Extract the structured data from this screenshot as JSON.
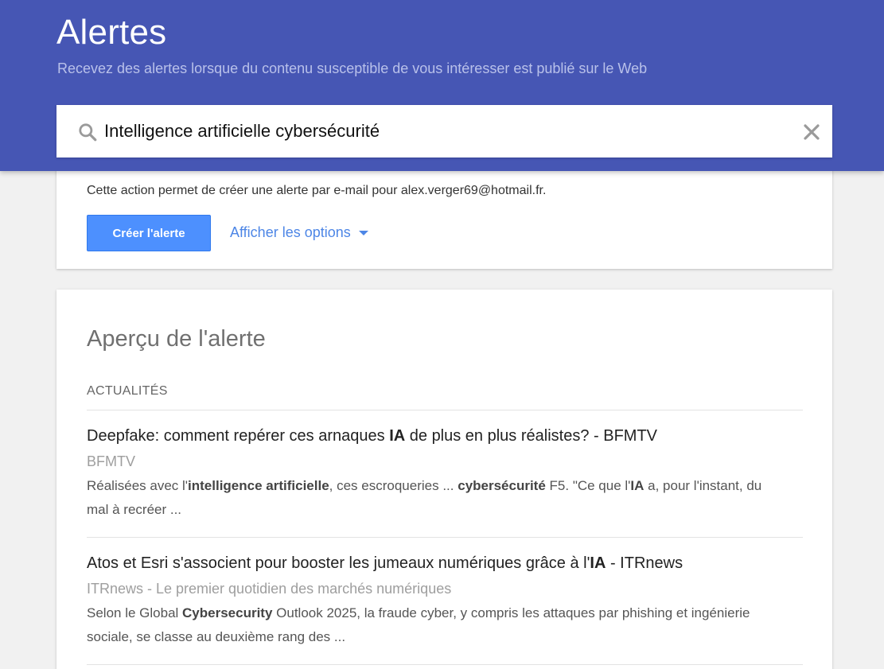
{
  "header": {
    "title": "Alertes",
    "subtitle": "Recevez des alertes lorsque du contenu susceptible de vous intéresser est publié sur le Web"
  },
  "search": {
    "value": "Intelligence artificielle cybersécurité"
  },
  "create_card": {
    "description": "Cette action permet de créer une alerte par e-mail pour alex.verger69@hotmail.fr.",
    "create_button": "Créer l'alerte",
    "options_link": "Afficher les options"
  },
  "preview": {
    "title": "Aperçu de l'alerte",
    "section_label": "ACTUALITÉS",
    "items": [
      {
        "title": [
          {
            "text": "Deepfake: comment repérer ces arnaques ",
            "bold": false
          },
          {
            "text": "IA",
            "bold": true
          },
          {
            "text": " de plus en plus réalistes? - BFMTV",
            "bold": false
          }
        ],
        "source": "BFMTV",
        "snippet": [
          {
            "text": "Réalisées avec l'",
            "bold": false
          },
          {
            "text": "intelligence artificielle",
            "bold": true
          },
          {
            "text": ", ces escroqueries ... ",
            "bold": false
          },
          {
            "text": "cybersécurité",
            "bold": true
          },
          {
            "text": " F5. \"Ce que l'",
            "bold": false
          },
          {
            "text": "IA",
            "bold": true
          },
          {
            "text": " a, pour l'instant, du mal à recréer ...",
            "bold": false
          }
        ]
      },
      {
        "title": [
          {
            "text": "Atos et Esri s'associent pour booster les jumeaux numériques grâce à l'",
            "bold": false
          },
          {
            "text": "IA",
            "bold": true
          },
          {
            "text": " - ITRnews",
            "bold": false
          }
        ],
        "source": "ITRnews - Le premier quotidien des marchés numériques",
        "snippet": [
          {
            "text": "Selon le Global ",
            "bold": false
          },
          {
            "text": "Cybersecurity",
            "bold": true
          },
          {
            "text": " Outlook 2025, la fraude cyber, y compris les attaques par phishing et ingénierie sociale, se classe au deuxième rang des ...",
            "bold": false
          }
        ]
      }
    ]
  },
  "colors": {
    "header_bg": "#4656b4",
    "accent_blue": "#4d90fe",
    "link_blue": "#4d86e6"
  },
  "icons": {
    "search": "search-icon",
    "clear": "close-icon",
    "options_caret": "caret-down-icon"
  }
}
